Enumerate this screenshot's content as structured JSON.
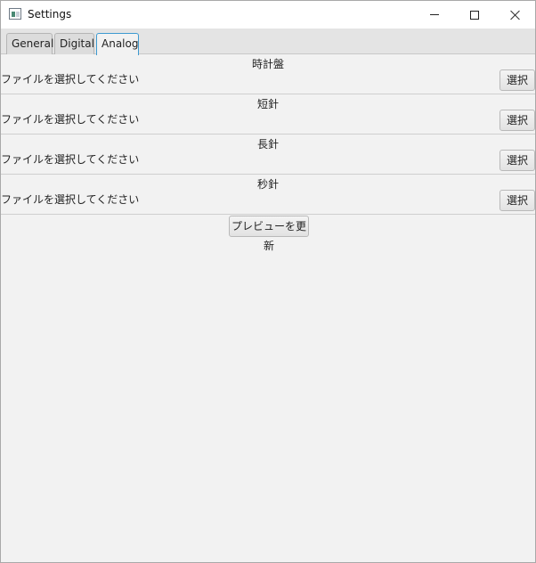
{
  "window": {
    "title": "Settings",
    "controls": {
      "minimize": "minimize-icon",
      "maximize": "maximize-icon",
      "close": "close-icon"
    }
  },
  "tabs": [
    {
      "label": "General",
      "selected": false
    },
    {
      "label": "Digital",
      "selected": false
    },
    {
      "label": "Analog",
      "selected": true
    }
  ],
  "sections": [
    {
      "title": "時計盤",
      "path_text": "ファイルを選択してください",
      "button_label": "選択"
    },
    {
      "title": "短針",
      "path_text": "ファイルを選択してください",
      "button_label": "選択"
    },
    {
      "title": "長針",
      "path_text": "ファイルを選択してください",
      "button_label": "選択"
    },
    {
      "title": "秒針",
      "path_text": "ファイルを選択してください",
      "button_label": "選択"
    }
  ],
  "preview_button_label": "プレビューを更新",
  "colors": {
    "accent_tab_border": "#3d9ad1",
    "background": "#f2f2f2"
  }
}
